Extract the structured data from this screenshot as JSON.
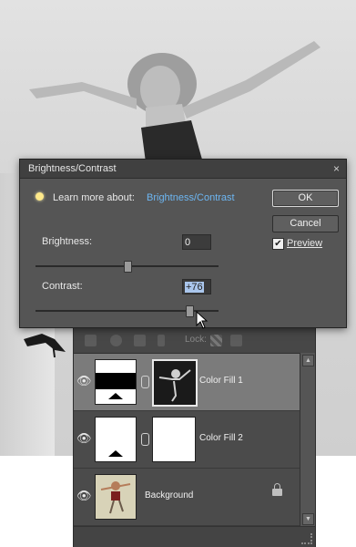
{
  "dialog": {
    "title": "Brightness/Contrast",
    "close_glyph": "×",
    "learn_prefix": "Learn more about:",
    "learn_link": "Brightness/Contrast",
    "brightness_label": "Brightness:",
    "brightness_value": "0",
    "brightness_level": 0,
    "contrast_label": "Contrast:",
    "contrast_value": "+76",
    "contrast_level": 76,
    "ok_label": "OK",
    "cancel_label": "Cancel",
    "preview_label": "Preview",
    "preview_checked": true
  },
  "layers_panel": {
    "lock_label": "Lock:",
    "layers": [
      {
        "name": "Color Fill 1",
        "selected": true
      },
      {
        "name": "Color Fill 2",
        "selected": false
      },
      {
        "name": "Background",
        "selected": false,
        "locked": true
      }
    ]
  },
  "colors": {
    "accent_link": "#6db6f2",
    "selected_row": "#7b7b7b"
  }
}
